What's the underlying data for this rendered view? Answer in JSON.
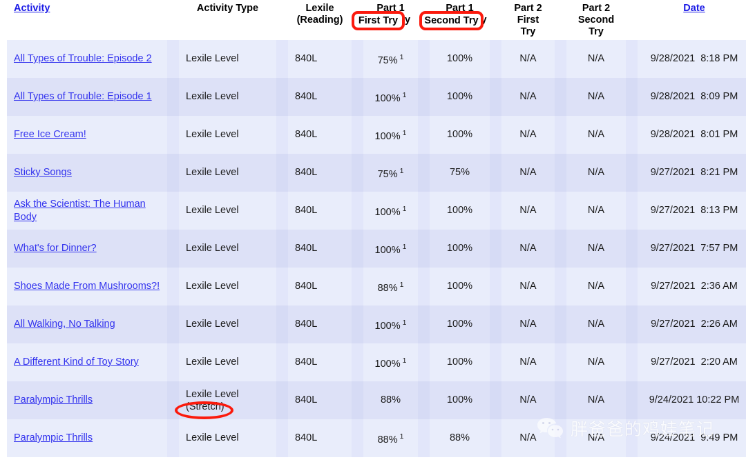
{
  "table": {
    "headers": {
      "activity": "Activity",
      "activity_type": "Activity Type",
      "lexile": "Lexile\n(Reading)",
      "part1_first": "Part 1\nFirst Try",
      "part1_second": "Part 1\nSecond Try",
      "part2_first": "Part 2\nFirst\nTry",
      "part2_second": "Part 2\nSecond\nTry",
      "date": "Date"
    },
    "rows": [
      {
        "activity": "All Types of Trouble: Episode 2",
        "activity_type": "Lexile Level",
        "lexile": "840L",
        "part1_first": "75%",
        "part1_first_marker": "1",
        "part1_second": "100%",
        "part2_first": "N/A",
        "part2_second": "N/A",
        "date": "9/28/2021  8:18 PM"
      },
      {
        "activity": "All Types of Trouble: Episode 1",
        "activity_type": "Lexile Level",
        "lexile": "840L",
        "part1_first": "100%",
        "part1_first_marker": "1",
        "part1_second": "100%",
        "part2_first": "N/A",
        "part2_second": "N/A",
        "date": "9/28/2021  8:09 PM"
      },
      {
        "activity": "Free Ice Cream!",
        "activity_type": "Lexile Level",
        "lexile": "840L",
        "part1_first": "100%",
        "part1_first_marker": "1",
        "part1_second": "100%",
        "part2_first": "N/A",
        "part2_second": "N/A",
        "date": "9/28/2021  8:01 PM"
      },
      {
        "activity": "Sticky Songs",
        "activity_type": "Lexile Level",
        "lexile": "840L",
        "part1_first": "75%",
        "part1_first_marker": "1",
        "part1_second": "75%",
        "part2_first": "N/A",
        "part2_second": "N/A",
        "date": "9/27/2021  8:21 PM"
      },
      {
        "activity": "Ask the Scientist: The Human Body",
        "activity_type": "Lexile Level",
        "lexile": "840L",
        "part1_first": "100%",
        "part1_first_marker": "1",
        "part1_second": "100%",
        "part2_first": "N/A",
        "part2_second": "N/A",
        "date": "9/27/2021  8:13 PM"
      },
      {
        "activity": "What's for Dinner?",
        "activity_type": "Lexile Level",
        "lexile": "840L",
        "part1_first": "100%",
        "part1_first_marker": "1",
        "part1_second": "100%",
        "part2_first": "N/A",
        "part2_second": "N/A",
        "date": "9/27/2021  7:57 PM"
      },
      {
        "activity": "Shoes Made From Mushrooms?!",
        "activity_type": "Lexile Level",
        "lexile": "840L",
        "part1_first": "88%",
        "part1_first_marker": "1",
        "part1_second": "100%",
        "part2_first": "N/A",
        "part2_second": "N/A",
        "date": "9/27/2021  2:36 AM"
      },
      {
        "activity": "All Walking, No Talking",
        "activity_type": "Lexile Level",
        "lexile": "840L",
        "part1_first": "100%",
        "part1_first_marker": "1",
        "part1_second": "100%",
        "part2_first": "N/A",
        "part2_second": "N/A",
        "date": "9/27/2021  2:26 AM"
      },
      {
        "activity": "A Different Kind of Toy Story",
        "activity_type": "Lexile Level",
        "lexile": "840L",
        "part1_first": "100%",
        "part1_first_marker": "1",
        "part1_second": "100%",
        "part2_first": "N/A",
        "part2_second": "N/A",
        "date": "9/27/2021  2:20 AM"
      },
      {
        "activity": "Paralympic Thrills",
        "activity_type": "Lexile Level\n(Stretch)",
        "lexile": "840L",
        "part1_first": "88%",
        "part1_first_marker": "",
        "part1_second": "100%",
        "part2_first": "N/A",
        "part2_second": "N/A",
        "date": "9/24/2021 10:22 PM"
      },
      {
        "activity": "Paralympic Thrills",
        "activity_type": "Lexile Level",
        "lexile": "840L",
        "part1_first": "88%",
        "part1_first_marker": "1",
        "part1_second": "88%",
        "part2_first": "N/A",
        "part2_second": "N/A",
        "date": "9/24/2021  9:49 PM"
      }
    ]
  },
  "annotations": {
    "first_try_label": "First Try",
    "second_try_label": "Second Try",
    "stretch_label": "(Stretch)",
    "color": "#fb1a0d"
  },
  "watermark": {
    "text": "胖爸爸的鸡娃笔记",
    "icon": "wechat-icon"
  },
  "colors": {
    "row_light": "#e9edfb",
    "row_dark": "#dde1f7",
    "link": "#3333ee",
    "header_link": "#1a1ae6",
    "annotation_red": "#fb1a0d"
  }
}
